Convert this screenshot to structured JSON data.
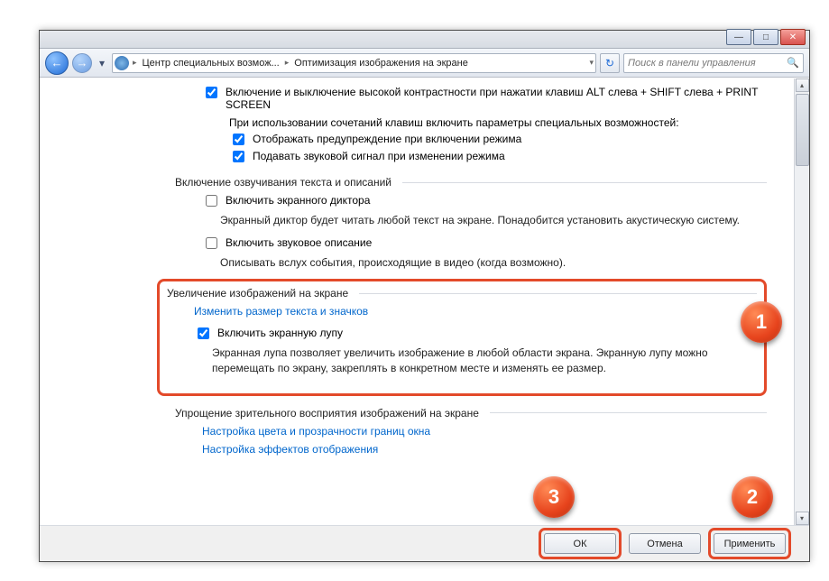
{
  "titlebar": {
    "min": "—",
    "max": "□",
    "close": "✕"
  },
  "address": {
    "back_glyph": "←",
    "fwd_glyph": "→",
    "dropdown_glyph": "▾",
    "crumb1": "Центр специальных возмож...",
    "arrow": "▸",
    "crumb2": "Оптимизация изображения на экране",
    "crumb_drop": "▾",
    "refresh_glyph": "↻",
    "search_placeholder": "Поиск в панели управления",
    "search_icon": "🔍"
  },
  "section_contrast": {
    "chk1": "Включение и выключение высокой контрастности при нажатии клавиш ALT слева + SHIFT слева + PRINT SCREEN",
    "note": "При использовании сочетаний клавиш включить параметры специальных возможностей:",
    "chk2": "Отображать предупреждение при включении режима",
    "chk3": "Подавать звуковой сигнал при изменении режима"
  },
  "section_narration": {
    "heading": "Включение озвучивания текста и описаний",
    "chk1": "Включить экранного диктора",
    "desc1": "Экранный диктор будет читать любой текст на экране. Понадобится установить акустическую систему.",
    "chk2": "Включить звуковое описание",
    "desc2": "Описывать вслух события, происходящие в видео (когда возможно)."
  },
  "section_magnify": {
    "heading": "Увеличение изображений на экране",
    "link": "Изменить размер текста и значков",
    "chk": "Включить экранную лупу",
    "desc": "Экранная лупа позволяет увеличить изображение в любой области экрана. Экранную лупу можно перемещать по экрану, закреплять в конкретном месте и изменять ее размер."
  },
  "section_simplify": {
    "heading": "Упрощение зрительного восприятия изображений на экране",
    "link1": "Настройка цвета и прозрачности границ окна",
    "link2": "Настройка эффектов отображения"
  },
  "footer": {
    "ok": "ОК",
    "cancel": "Отмена",
    "apply": "Применить"
  },
  "markers": {
    "m1": "1",
    "m2": "2",
    "m3": "3"
  },
  "scroll": {
    "up": "▴",
    "down": "▾"
  }
}
